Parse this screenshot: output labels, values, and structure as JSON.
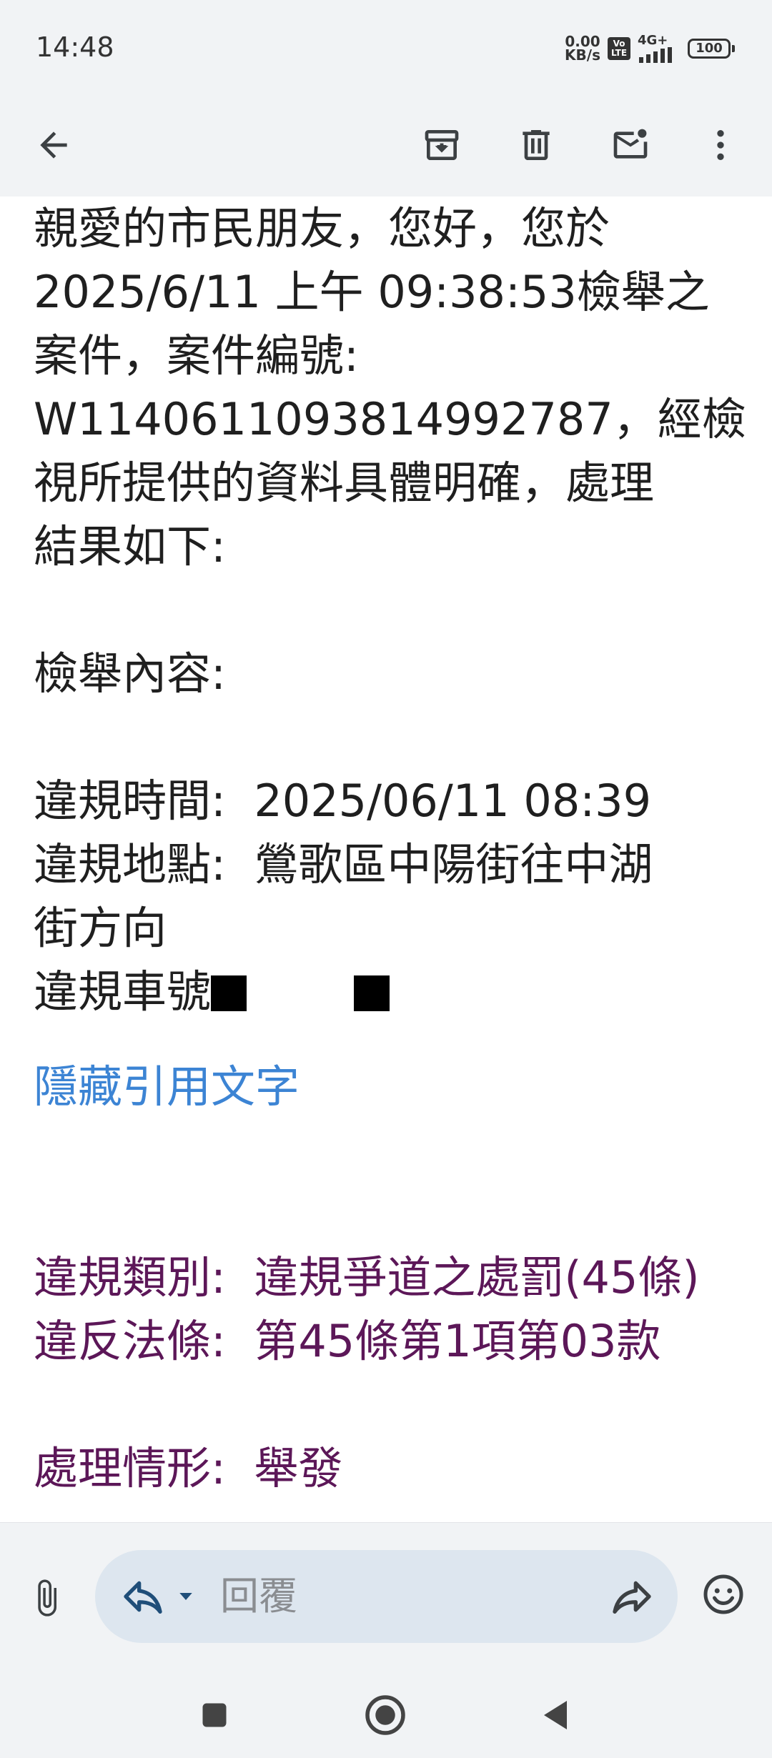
{
  "status": {
    "time": "14:48",
    "net_speed_value": "0.00",
    "net_speed_unit": "KB/s",
    "volte_line1": "Vo",
    "volte_line2": "LTE",
    "network": "4G+",
    "battery": "100"
  },
  "toolbar": {
    "icons": [
      "back-arrow-icon",
      "archive-icon",
      "delete-icon",
      "mark-unread-icon",
      "more-icon"
    ]
  },
  "email": {
    "intro": "親愛的市民朋友，您好，您於\n2025/6/11 上午 09:38:53檢舉之\n案件，案件編號:\nW114061109381499278​7，經檢\n視所提供的資料具體明確，處理\n結果如下:",
    "section_title": "檢舉內容:",
    "violation_time_label": "違規時間:  ",
    "violation_time": "2025/06/11 08:39",
    "violation_place_label": "違規地點:  ",
    "violation_place": "鶯歌區中陽街往中湖\n街方向",
    "plate_label": "違規車號",
    "show_quoted": "隱藏引用文字",
    "category_label": "違規類別:  ",
    "category": "違規爭道之處罰(45條)",
    "law_label": "違反法條:  ",
    "law": "第45條第1項第03款",
    "status_label": "處理情形:  ",
    "status_value": "舉發"
  },
  "reply": {
    "placeholder": "回覆"
  },
  "colors": {
    "link": "#3c84d4",
    "quoted_purple": "#5c1758",
    "bar_bg": "#f1f3f5",
    "pill_bg": "#dde6ef"
  }
}
